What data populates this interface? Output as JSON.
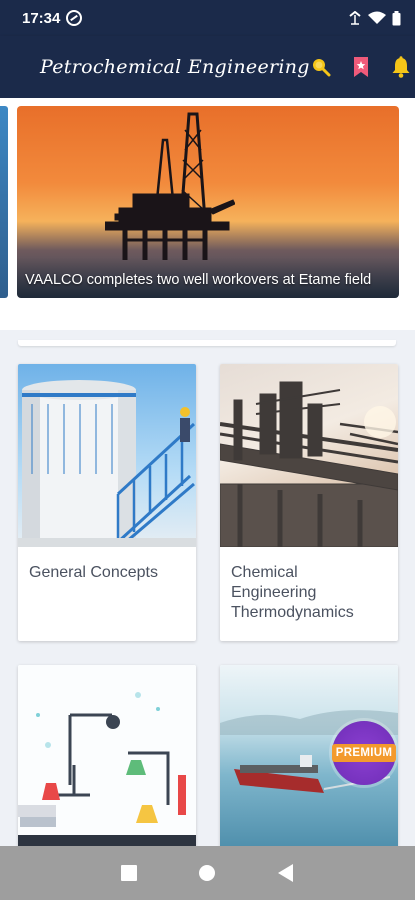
{
  "status_bar": {
    "time": "17:34"
  },
  "app_bar": {
    "title": "Petrochemical Engineering",
    "icons": [
      "menu-icon",
      "search-icon",
      "bookmark-icon",
      "bell-icon"
    ],
    "accent_color": "#f5c518",
    "background_color": "#1b2a4a"
  },
  "carousel": {
    "headline": "VAALCO completes two well workovers at Etame field"
  },
  "categories": [
    {
      "label": "General Concepts"
    },
    {
      "label": "Chemical Engineering Thermodynamics"
    },
    {
      "label": ""
    },
    {
      "label": "",
      "badge": "PREMIUM"
    }
  ],
  "navigation": {
    "buttons": [
      "recents-button",
      "home-button",
      "back-button"
    ]
  }
}
